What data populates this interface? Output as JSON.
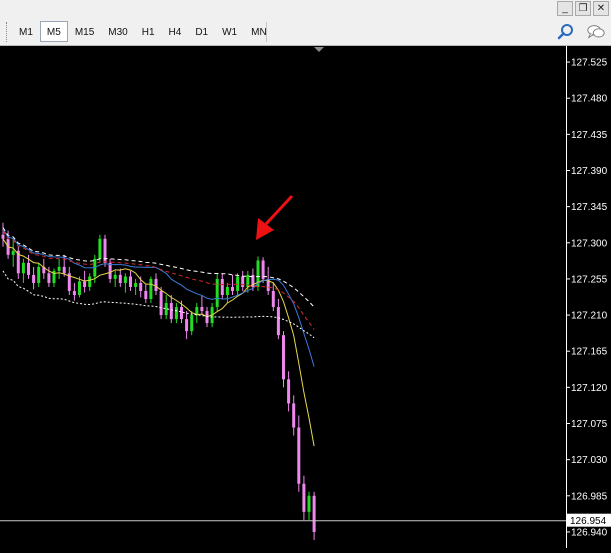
{
  "window_controls": [
    "_",
    "❐",
    "✕"
  ],
  "timeframes": [
    "M1",
    "M5",
    "M15",
    "M30",
    "H1",
    "H4",
    "D1",
    "W1",
    "MN"
  ],
  "active_timeframe": "M5",
  "toolbar_icons": [
    "search-icon",
    "chat-icon"
  ],
  "colors": {
    "background": "#000000",
    "axis": "#ffffff",
    "bull_candle": "#22dd22",
    "bear_candle": "#ee88ee",
    "ma_blue": "#3b7bd8",
    "ma_yellow": "#e7d84a",
    "ma_red": "#d42a2a",
    "ma_white_dashed": "#ffffff",
    "ma_white_dotted": "#ffffff",
    "arrow": "#ee1111",
    "bid_line": "#c8c8c8"
  },
  "chart_data": {
    "type": "candlestick",
    "y_axis_labels": [
      "127.525",
      "127.480",
      "127.435",
      "127.390",
      "127.345",
      "127.300",
      "127.255",
      "127.210",
      "127.165",
      "127.120",
      "127.075",
      "127.030",
      "126.985",
      "126.940"
    ],
    "ylim": [
      126.92,
      127.545
    ],
    "current_price": "126.954",
    "candles": [
      [
        127.31,
        127.325,
        127.295,
        127.305
      ],
      [
        127.305,
        127.315,
        127.28,
        127.285
      ],
      [
        127.285,
        127.305,
        127.27,
        127.29
      ],
      [
        127.29,
        127.295,
        127.255,
        127.262
      ],
      [
        127.262,
        127.28,
        127.25,
        127.275
      ],
      [
        127.275,
        127.285,
        127.255,
        127.26
      ],
      [
        127.26,
        127.27,
        127.242,
        127.25
      ],
      [
        127.25,
        127.275,
        127.245,
        127.27
      ],
      [
        127.27,
        127.28,
        127.255,
        127.262
      ],
      [
        127.262,
        127.27,
        127.245,
        127.25
      ],
      [
        127.25,
        127.268,
        127.245,
        127.265
      ],
      [
        127.265,
        127.28,
        127.255,
        127.27
      ],
      [
        127.27,
        127.285,
        127.258,
        127.262
      ],
      [
        127.262,
        127.27,
        127.235,
        127.24
      ],
      [
        127.24,
        127.25,
        127.228,
        127.235
      ],
      [
        127.235,
        127.258,
        127.232,
        127.252
      ],
      [
        127.252,
        127.265,
        127.238,
        127.245
      ],
      [
        127.245,
        127.262,
        127.24,
        127.258
      ],
      [
        127.258,
        127.285,
        127.25,
        127.28
      ],
      [
        127.28,
        127.31,
        127.275,
        127.305
      ],
      [
        127.305,
        127.31,
        127.27,
        127.275
      ],
      [
        127.275,
        127.28,
        127.25,
        127.255
      ],
      [
        127.255,
        127.265,
        127.245,
        127.26
      ],
      [
        127.26,
        127.268,
        127.245,
        127.25
      ],
      [
        127.25,
        127.262,
        127.238,
        127.258
      ],
      [
        127.258,
        127.265,
        127.24,
        127.245
      ],
      [
        127.245,
        127.255,
        127.235,
        127.25
      ],
      [
        127.25,
        127.258,
        127.232,
        127.24
      ],
      [
        127.24,
        127.248,
        127.225,
        127.23
      ],
      [
        127.23,
        127.258,
        127.225,
        127.255
      ],
      [
        127.255,
        127.262,
        127.235,
        127.24
      ],
      [
        127.24,
        127.245,
        127.205,
        127.21
      ],
      [
        127.21,
        127.235,
        127.205,
        127.225
      ],
      [
        127.225,
        127.235,
        127.2,
        127.205
      ],
      [
        127.205,
        127.225,
        127.2,
        127.22
      ],
      [
        127.22,
        127.228,
        127.2,
        127.205
      ],
      [
        127.205,
        127.215,
        127.18,
        127.19
      ],
      [
        127.19,
        127.215,
        127.185,
        127.21
      ],
      [
        127.21,
        127.225,
        127.2,
        127.22
      ],
      [
        127.22,
        127.235,
        127.21,
        127.215
      ],
      [
        127.215,
        127.22,
        127.195,
        127.2
      ],
      [
        127.2,
        127.225,
        127.195,
        127.22
      ],
      [
        127.22,
        127.262,
        127.215,
        127.255
      ],
      [
        127.255,
        127.262,
        127.23,
        127.235
      ],
      [
        127.235,
        127.25,
        127.225,
        127.245
      ],
      [
        127.245,
        127.26,
        127.235,
        127.24
      ],
      [
        127.24,
        127.262,
        127.235,
        127.258
      ],
      [
        127.258,
        127.265,
        127.24,
        127.245
      ],
      [
        127.245,
        127.265,
        127.238,
        127.26
      ],
      [
        127.26,
        127.268,
        127.24,
        127.245
      ],
      [
        127.245,
        127.283,
        127.24,
        127.278
      ],
      [
        127.278,
        127.282,
        127.25,
        127.255
      ],
      [
        127.255,
        127.27,
        127.235,
        127.24
      ],
      [
        127.24,
        127.25,
        127.215,
        127.22
      ],
      [
        127.22,
        127.23,
        127.18,
        127.185
      ],
      [
        127.185,
        127.19,
        127.12,
        127.13
      ],
      [
        127.13,
        127.14,
        127.09,
        127.1
      ],
      [
        127.1,
        127.11,
        127.06,
        127.07
      ],
      [
        127.07,
        127.085,
        126.99,
        127.0
      ],
      [
        127.0,
        127.01,
        126.955,
        126.965
      ],
      [
        126.965,
        126.99,
        126.955,
        126.985
      ],
      [
        126.985,
        126.99,
        126.93,
        126.94
      ]
    ]
  }
}
